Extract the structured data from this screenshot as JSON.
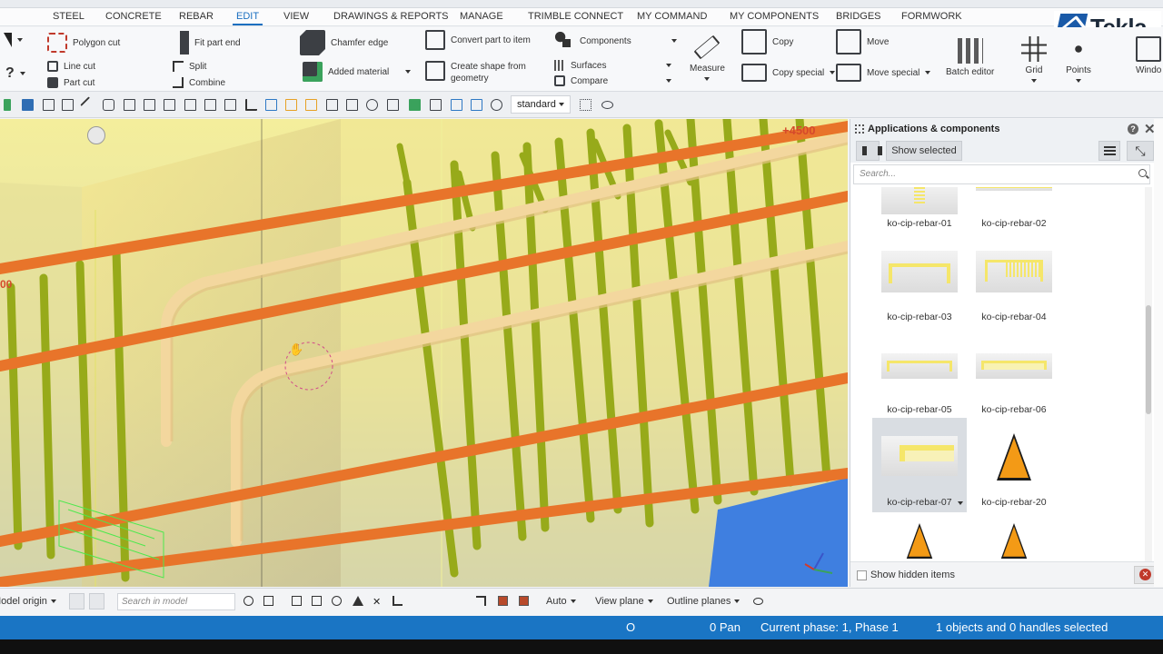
{
  "menu": {
    "items": [
      "STEEL",
      "CONCRETE",
      "REBAR",
      "EDIT",
      "VIEW",
      "DRAWINGS & REPORTS",
      "MANAGE",
      "TRIMBLE CONNECT",
      "MY COMMAND",
      "MY COMPONENTS",
      "BRIDGES",
      "FORMWORK"
    ],
    "active": "EDIT"
  },
  "brand": {
    "logo_text": "Tekla"
  },
  "ribbon": {
    "polygon_cut": "Polygon cut",
    "line_cut": "Line cut",
    "part_cut": "Part cut",
    "fit_part_end": "Fit part end",
    "split": "Split",
    "combine": "Combine",
    "chamfer_edge": "Chamfer edge",
    "added_material": "Added material",
    "convert_part_to_item": "Convert part to item",
    "create_shape_line1": "Create shape from",
    "create_shape_line2": "geometry",
    "components": "Components",
    "surfaces": "Surfaces",
    "compare": "Compare",
    "measure": "Measure",
    "copy": "Copy",
    "copy_special": "Copy special",
    "move": "Move",
    "move_special": "Move special",
    "batch_editor": "Batch editor",
    "grid": "Grid",
    "points": "Points",
    "window": "Windo"
  },
  "toolbar2": {
    "view_filter": "standard"
  },
  "viewport": {
    "elevation_label": "+4500",
    "left_label": "00"
  },
  "panel": {
    "title": "Applications & components",
    "show_selected": "Show selected",
    "search_placeholder": "Search...",
    "items": [
      "ko-cip-rebar-01",
      "ko-cip-rebar-02",
      "ko-cip-rebar-03",
      "ko-cip-rebar-04",
      "ko-cip-rebar-05",
      "ko-cip-rebar-06",
      "ko-cip-rebar-07",
      "ko-cip-rebar-20"
    ],
    "selected_item": "ko-cip-rebar-07",
    "show_hidden_items": "Show hidden items"
  },
  "bottombar": {
    "model_origin": "Model origin",
    "search_placeholder": "Search in model",
    "snap_mode": "Auto",
    "view_plane": "View plane",
    "outline_planes": "Outline planes"
  },
  "status": {
    "mode": "O",
    "pan": "0  Pan",
    "phase": "Current phase: 1, Phase 1",
    "selection": "1 objects and 0 handles selected"
  },
  "colors": {
    "accent": "#1b6fc0",
    "status_bar": "#1a75c4",
    "rebar_orange": "#e8742a",
    "rebar_green": "#9aac1a",
    "rebar_cream": "#f5dca4",
    "concrete_yellow": "#f6ee98"
  }
}
